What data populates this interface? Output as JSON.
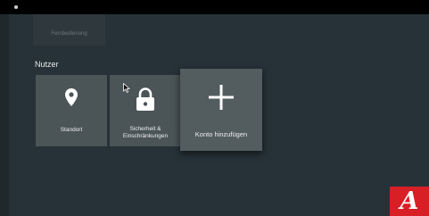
{
  "remote_card": {
    "label": "Fernbedienung"
  },
  "section": {
    "title": "Nutzer"
  },
  "tiles": [
    {
      "label": "Standort",
      "icon": "location-pin-icon"
    },
    {
      "label_line1": "Sicherheit &",
      "label_line2": "Einschränkungen",
      "icon": "lock-icon"
    },
    {
      "label": "Konto hinzufügen",
      "icon": "plus-icon"
    }
  ],
  "badge": {
    "text": "A"
  },
  "colors": {
    "background": "#263238",
    "tile": "#4b5456",
    "tile_focused": "#535c5f",
    "badge": "#d81f26"
  }
}
